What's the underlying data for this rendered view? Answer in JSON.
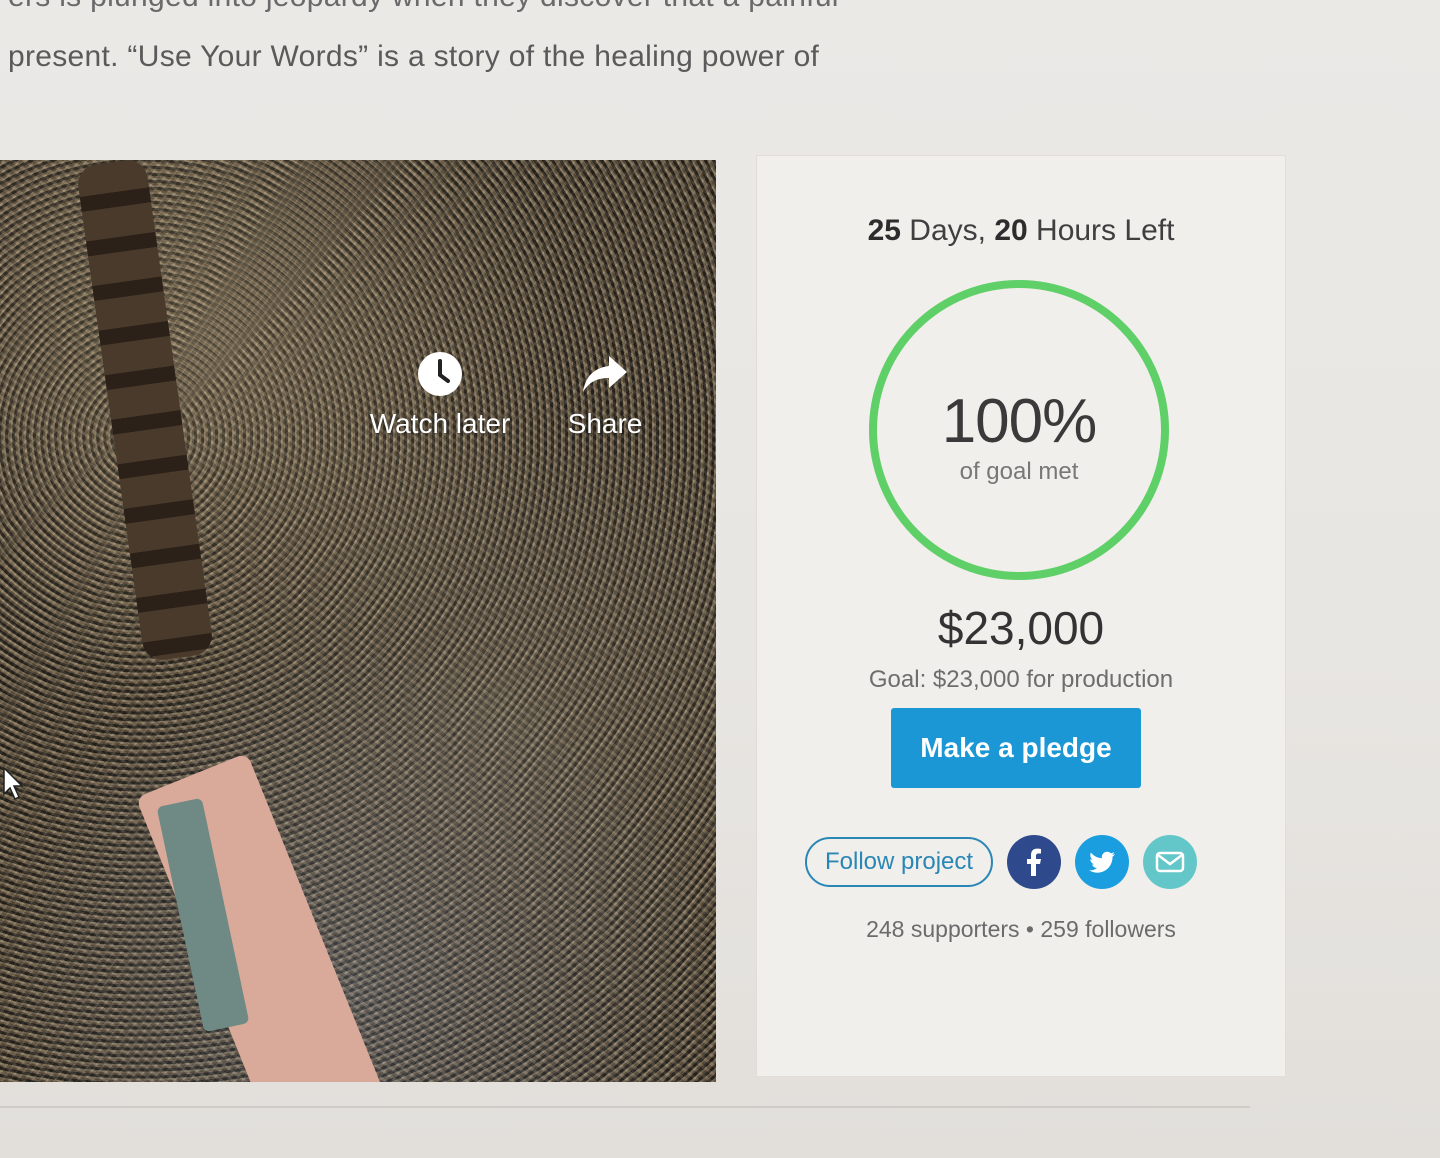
{
  "description": {
    "line1": "ers is plunged into jeopardy when they discover that a painful",
    "line2": "present. “Use Your Words” is a story of the healing power of"
  },
  "video": {
    "watch_later_label": "Watch later",
    "share_label": "Share",
    "icons": {
      "watch_later": "clock-icon",
      "share": "share-arrow-icon"
    }
  },
  "campaign": {
    "days": "25",
    "days_unit": " Days, ",
    "hours": "20",
    "hours_unit": " Hours Left",
    "progress_percent": "100%",
    "progress_fraction": 1.0,
    "progress_label": "of goal met",
    "amount_raised": "$23,000",
    "goal_text": "Goal: $23,000 for production",
    "pledge_label": "Make a pledge",
    "follow_label": "Follow project",
    "supporters": "248 supporters",
    "separator": " • ",
    "followers": "259 followers",
    "colors": {
      "progress_ring": "#5fd068",
      "pledge_button": "#1c97d5",
      "facebook": "#2f4a8c",
      "twitter": "#1a9ee0",
      "email": "#63c6c9"
    },
    "social_icons": [
      "facebook-icon",
      "twitter-icon",
      "email-icon"
    ]
  }
}
